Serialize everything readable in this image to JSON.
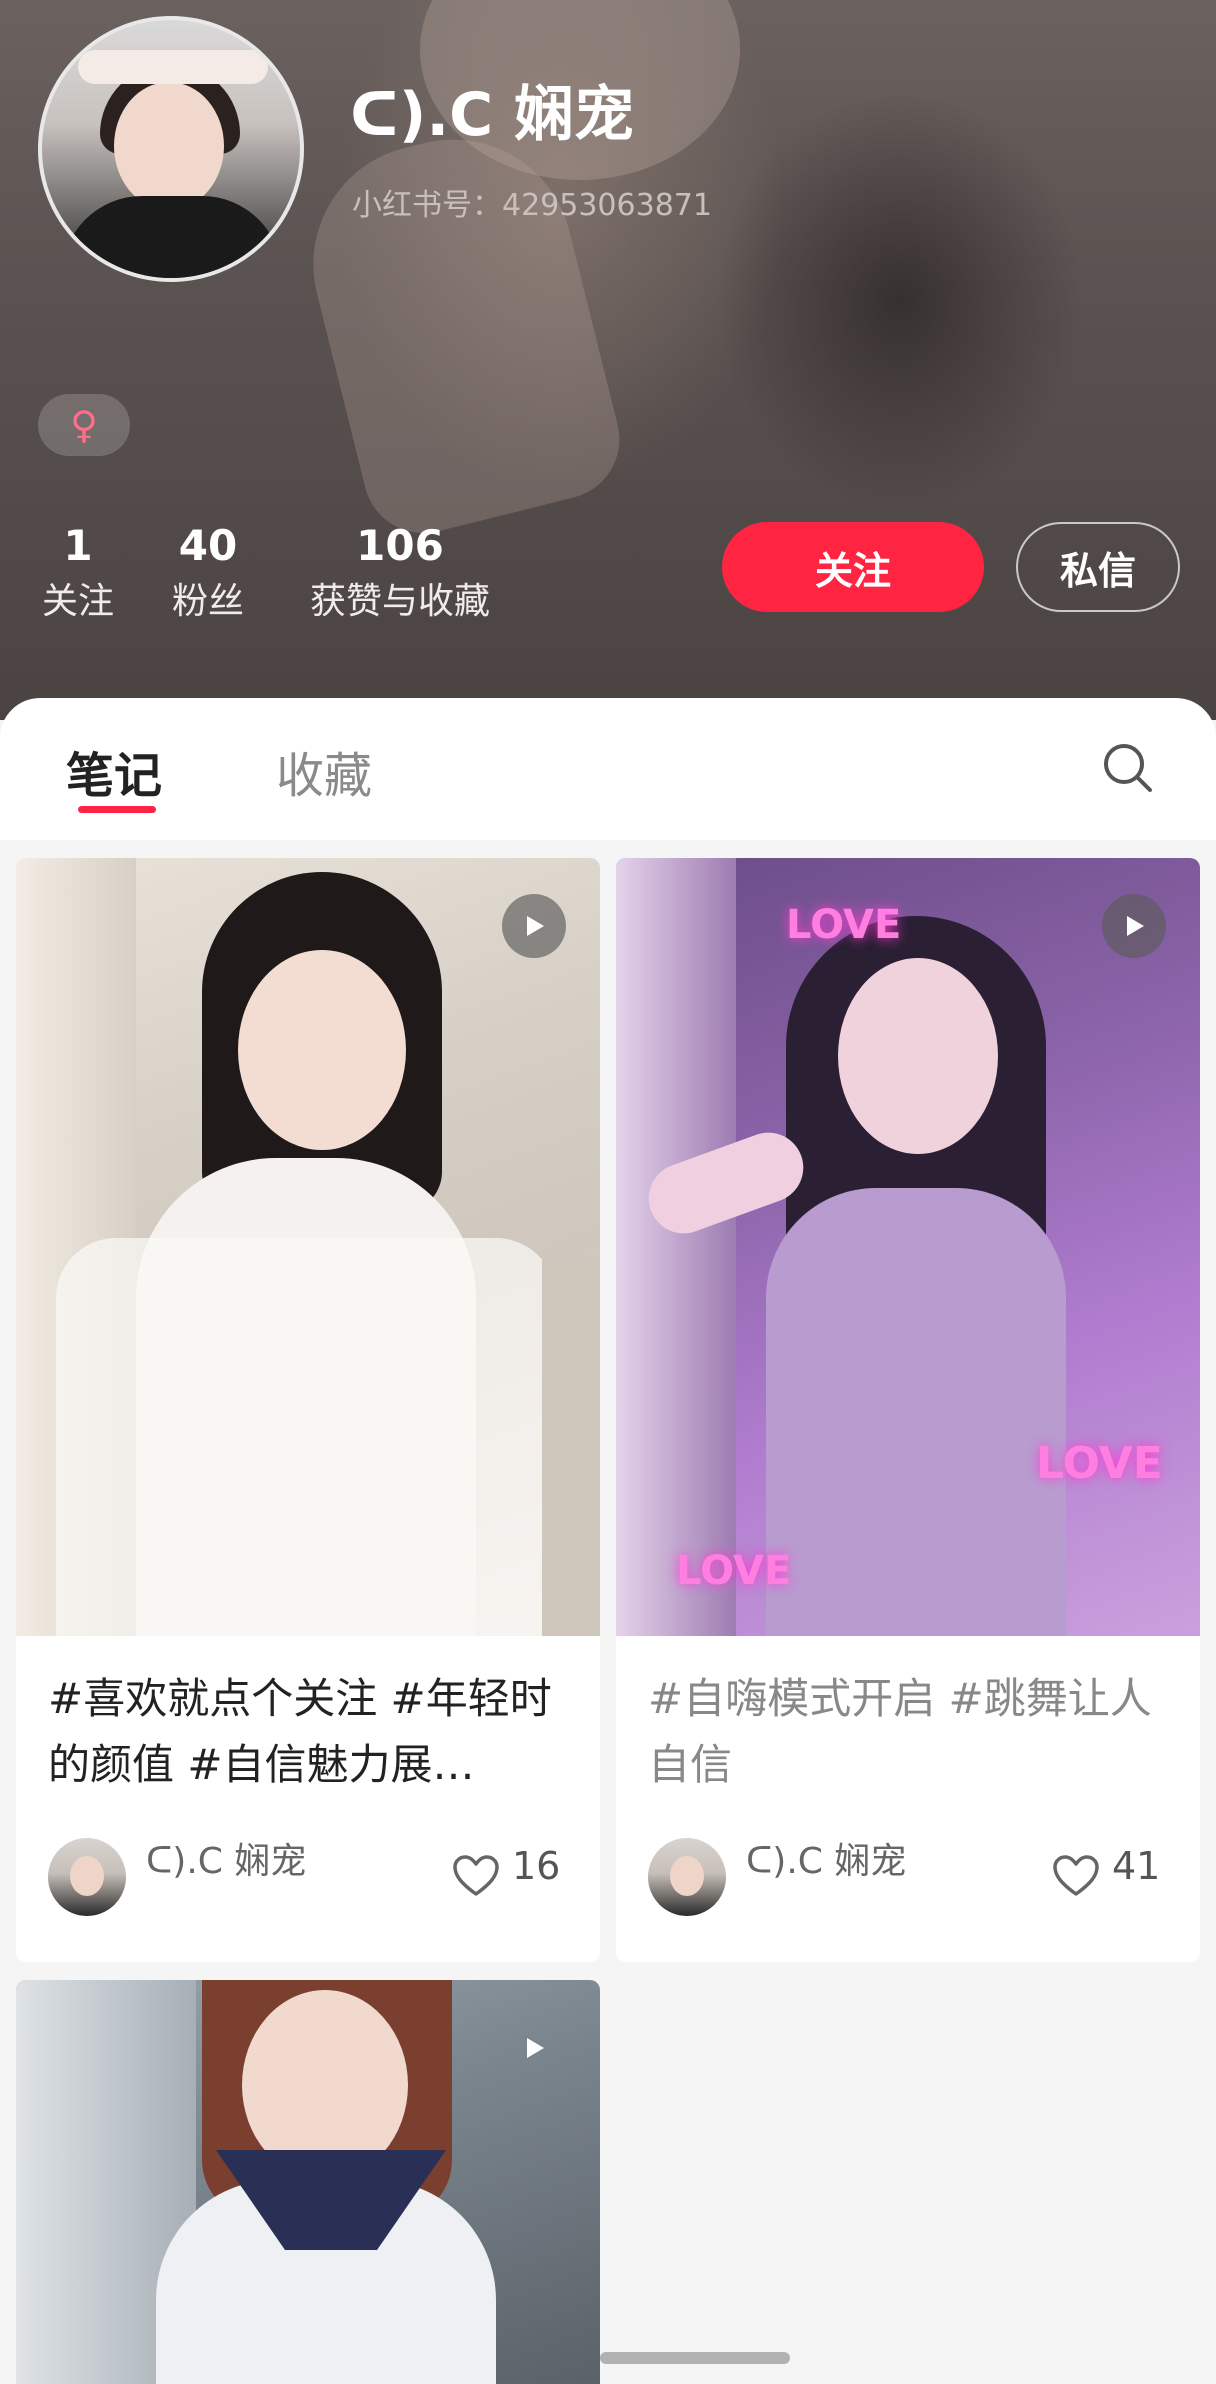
{
  "profile": {
    "nickname": "ᑕ).C 娴宠",
    "red_id": "小红书号：42953063871",
    "gender_symbol": "♀",
    "stats": [
      {
        "num": "1",
        "label": "关注"
      },
      {
        "num": "40",
        "label": "粉丝"
      },
      {
        "num": "106",
        "label": "获赞与收藏"
      }
    ],
    "follow_label": "关注",
    "message_label": "私信"
  },
  "tabs": {
    "notes_label": "笔记",
    "collect_label": "收藏"
  },
  "notes": [
    {
      "title": "#喜欢就点个关注 #年轻时的颜值 #自信魅力展…",
      "author": "ᑕ).C 娴宠",
      "likes": "16",
      "is_video": true
    },
    {
      "title": "#自嗨模式开启 #跳舞让人自信",
      "author": "ᑕ).C 娴宠",
      "likes": "41",
      "is_video": true,
      "overlay_words": [
        "LOVE",
        "LOVE",
        "LOVE"
      ]
    },
    {
      "is_video": true
    }
  ],
  "colors": {
    "accent": "#ff2442",
    "header_bg": "#5a5250",
    "gender": "#ff6f8a"
  },
  "icons": {
    "search": "search-icon",
    "play": "play-icon",
    "like": "heart-icon",
    "gender": "female-icon"
  }
}
